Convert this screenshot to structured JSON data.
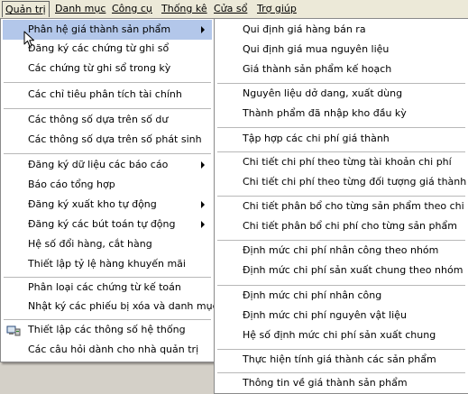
{
  "menubar": {
    "items": [
      "Quản trị",
      "Danh mục",
      "Công cụ",
      "Thống kê",
      "Cửa sổ",
      "Trợ giúp"
    ]
  },
  "main_menu": {
    "items": [
      "Phân hệ giá thành sản phẩm",
      "Đăng ký các chứng từ ghi sổ",
      "Các chứng từ ghi sổ trong kỳ",
      "Các chỉ tiêu phân tích tài chính",
      "Các thông số dựa trên số dư",
      "Các thông số dựa trên số phát sinh",
      "Đăng ký dữ liệu các báo cáo",
      "Báo cáo tổng hợp",
      "Đăng ký xuất kho tự động",
      "Đăng ký các bút toán tự động",
      "Hệ số đổi hàng, cắt hàng",
      "Thiết lập tỷ lệ hàng khuyến mãi",
      "Phân loại các chứng từ kế toán",
      "Nhật ký các phiếu bị xóa và danh mục",
      "Thiết lập các thông số hệ thống",
      "Các câu hỏi dành cho nhà quản trị"
    ]
  },
  "sub_menu": {
    "items": [
      "Qui định giá hàng bán ra",
      "Qui định giá mua nguyên liệu",
      "Giá thành sản phẩm kế hoạch",
      "Nguyên liệu dở dang, xuất dùng",
      "Thành phẩm đã nhập kho đầu kỳ",
      "Tập hợp các chi phí giá thành",
      "Chi tiết chi phí theo từng tài khoản chi phí",
      "Chi tiết chi phí theo từng đối tượng giá thành",
      "Chi tiết phân bổ cho từng sản phẩm theo chi phí",
      "Chi tiết phân bổ chi phí cho từng sản phẩm",
      "Định mức chi phí nhân công theo nhóm",
      "Định mức chi phí sản xuất chung theo nhóm",
      "Định mức chi phí nhân công",
      "Định mức chi phí nguyên vật liệu",
      "Hệ số định mức chi phí sản xuất chung",
      "Thực hiện tính giá thành các sản phẩm",
      "Thông tin về giá thành sản phẩm"
    ]
  },
  "colors": {
    "highlight": "#b3c7ea",
    "menubar": "#ece9d8",
    "background": "#d4d0c8"
  },
  "icons": [
    "submenu-arrow-icon",
    "system-settings-icon",
    "mouse-cursor-icon"
  ]
}
